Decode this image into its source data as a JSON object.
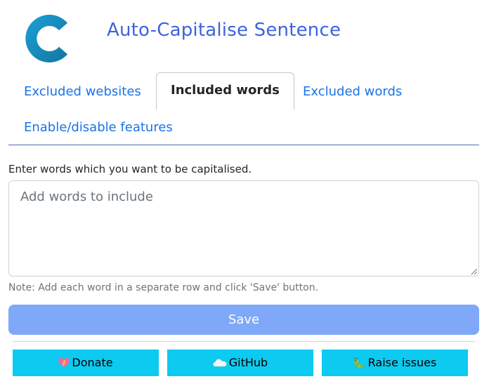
{
  "header": {
    "title": "Auto-Capitalise Sentence",
    "logo_letter": "C",
    "logo_color": "#1c8fc4"
  },
  "tabs": [
    {
      "label": "Excluded websites",
      "active": false
    },
    {
      "label": "Included words",
      "active": true
    },
    {
      "label": "Excluded words",
      "active": false
    },
    {
      "label": "Enable/disable features",
      "active": false
    }
  ],
  "form": {
    "prompt": "Enter words which you want to be capitalised.",
    "textarea_placeholder": "Add words to include",
    "textarea_value": "",
    "note": "Note: Add each word in a separate row and click 'Save' button.",
    "save_label": "Save"
  },
  "footer": {
    "donate_label": "Donate",
    "donate_icon": "heart-icon",
    "github_label": "GitHub",
    "github_icon": "cloud-icon",
    "issues_label": "Raise issues",
    "issues_icon": "bug-icon"
  },
  "colors": {
    "accent": "#3e63dd",
    "tab_link": "#1a73e8",
    "save_button": "#7fa8f8",
    "footer_button": "#0dcaf0"
  }
}
